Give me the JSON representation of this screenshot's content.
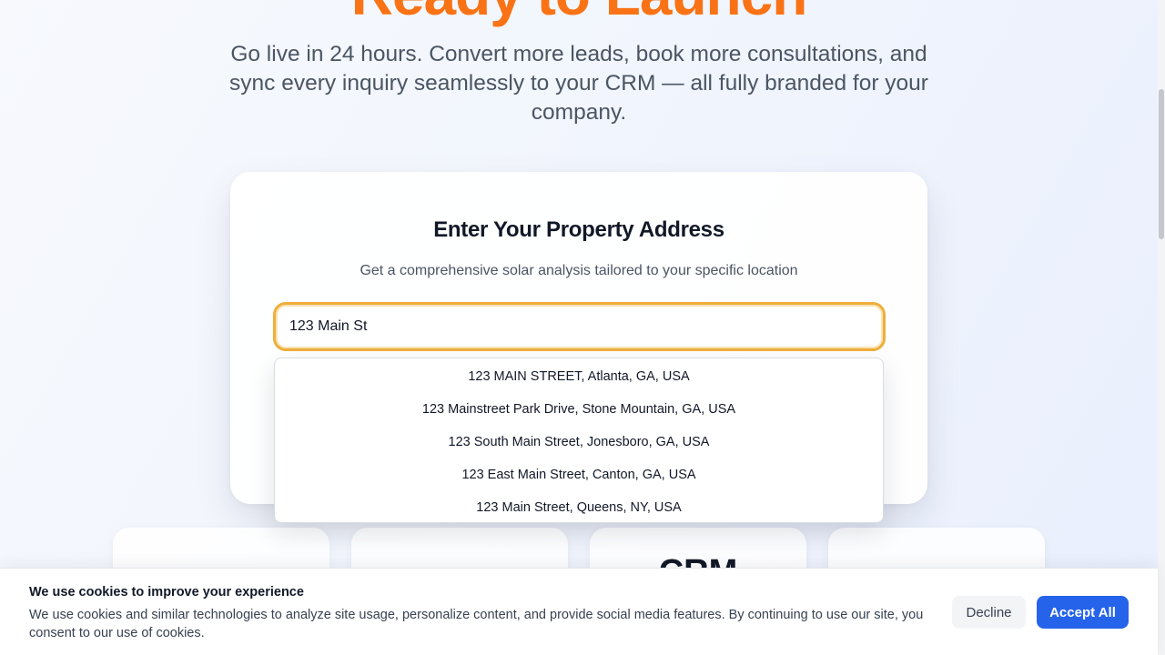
{
  "hero": {
    "title": "Ready to Launch",
    "subtitle": "Go live in 24 hours. Convert more leads, book more consultations, and sync every inquiry seamlessly to your CRM — all fully branded for your company."
  },
  "address_card": {
    "title": "Enter Your Property Address",
    "subtitle": "Get a comprehensive solar analysis tailored to your specific location",
    "input_value": "123 Main St"
  },
  "suggestions": [
    "123 MAIN STREET, Atlanta, GA, USA",
    "123 Mainstreet Park Drive, Stone Mountain, GA, USA",
    "123 South Main Street, Jonesboro, GA, USA",
    "123 East Main Street, Canton, GA, USA",
    "123 Main Street, Queens, NY, USA"
  ],
  "features": {
    "crm_label": "CRM"
  },
  "cookie_banner": {
    "title": "We use cookies to improve your experience",
    "text": "We use cookies and similar technologies to analyze site usage, personalize content, and provide social media features. By continuing to use our site, you consent to our use of cookies.",
    "decline_label": "Decline",
    "accept_label": "Accept All"
  },
  "colors": {
    "accent_orange": "#f97316",
    "primary_blue": "#2563eb",
    "focus_ring": "#f0ae3a"
  }
}
